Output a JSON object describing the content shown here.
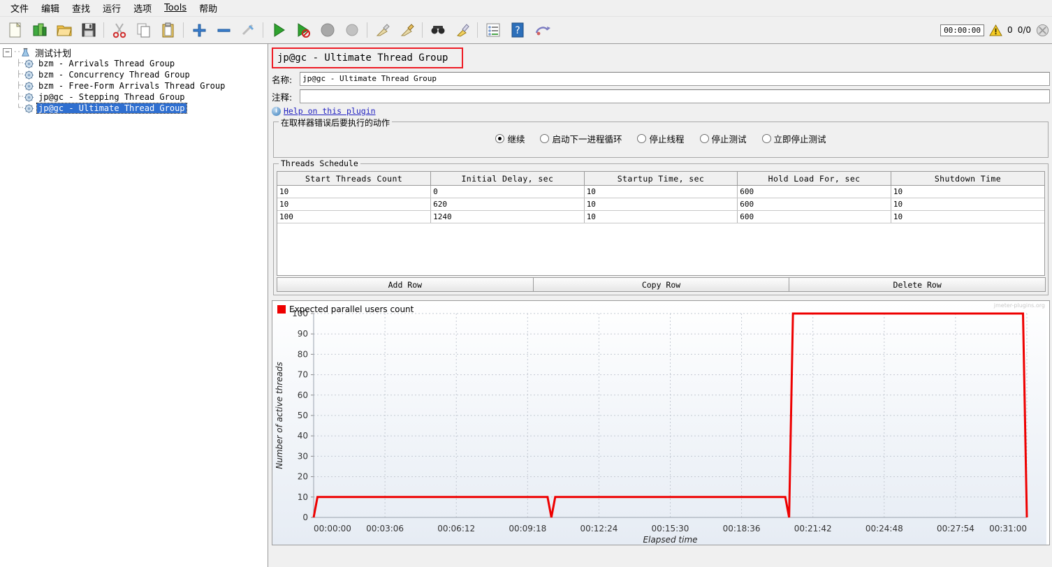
{
  "menu": {
    "items": [
      {
        "label": "文件"
      },
      {
        "label": "编辑"
      },
      {
        "label": "查找"
      },
      {
        "label": "运行"
      },
      {
        "label": "选项"
      },
      {
        "label": "Tools",
        "mnemonic": "T"
      },
      {
        "label": "帮助"
      }
    ]
  },
  "toolbar": {
    "icons": [
      "new-file-icon",
      "templates-icon",
      "open-folder-icon",
      "save-icon",
      "cut-icon",
      "copy-icon",
      "paste-icon",
      "expand-icon",
      "collapse-icon",
      "toggle-icon",
      "start-icon",
      "start-no-pauses-icon",
      "stop-icon",
      "shutdown-icon",
      "clear-icon",
      "clear-all-icon",
      "search-icon",
      "search-reset-icon",
      "function-helper-icon",
      "help-icon",
      "undo-redo-icon"
    ],
    "timer": "00:00:00",
    "warning_count": "0",
    "thread_count": "0/0",
    "status_icon": "disabled-icon"
  },
  "tree": {
    "root": {
      "label": "测试计划",
      "icon": "test-plan-icon",
      "expanded": true,
      "handle": "−"
    },
    "items": [
      {
        "label": "bzm - Arrivals Thread Group",
        "icon": "thread-group-icon",
        "selected": false
      },
      {
        "label": "bzm - Concurrency Thread Group",
        "icon": "thread-group-icon",
        "selected": false
      },
      {
        "label": "bzm - Free-Form Arrivals Thread Group",
        "icon": "thread-group-icon",
        "selected": false
      },
      {
        "label": "jp@gc - Stepping Thread Group",
        "icon": "thread-group-icon",
        "selected": false
      },
      {
        "label": "jp@gc - Ultimate Thread Group",
        "icon": "thread-group-icon",
        "selected": true
      }
    ]
  },
  "panel": {
    "title": "jp@gc - Ultimate Thread Group",
    "title_border_color": "#ee1c25",
    "name_label": "名称:",
    "name_value": "jp@gc - Ultimate Thread Group",
    "comment_label": "注释:",
    "comment_value": "",
    "help_link": "Help on this plugin",
    "error_action": {
      "legend": "在取样器错误后要执行的动作",
      "options": [
        {
          "label": "继续",
          "selected": true
        },
        {
          "label": "启动下一进程循环",
          "selected": false
        },
        {
          "label": "停止线程",
          "selected": false
        },
        {
          "label": "停止测试",
          "selected": false
        },
        {
          "label": "立即停止测试",
          "selected": false
        }
      ]
    },
    "schedule": {
      "legend": "Threads Schedule",
      "columns": [
        "Start Threads Count",
        "Initial Delay, sec",
        "Startup Time, sec",
        "Hold Load For, sec",
        "Shutdown Time"
      ],
      "rows": [
        [
          "10",
          "0",
          "10",
          "600",
          "10"
        ],
        [
          "10",
          "620",
          "10",
          "600",
          "10"
        ],
        [
          "100",
          "1240",
          "10",
          "600",
          "10"
        ]
      ]
    },
    "buttons": [
      {
        "label": "Add Row",
        "name": "add-row-button"
      },
      {
        "label": "Copy Row",
        "name": "copy-row-button"
      },
      {
        "label": "Delete Row",
        "name": "delete-row-button"
      }
    ]
  },
  "chart_data": {
    "type": "line",
    "title": "",
    "legend": [
      {
        "name": "Expected parallel users count",
        "color": "#ee0000"
      }
    ],
    "legend_position": "top-left",
    "watermark": "jmeter-plugins.org",
    "xlabel": "Elapsed time",
    "ylabel": "Number of active threads",
    "xticks": [
      "00:00:00",
      "00:03:06",
      "00:06:12",
      "00:09:18",
      "00:12:24",
      "00:15:30",
      "00:18:36",
      "00:21:42",
      "00:24:48",
      "00:27:54",
      "00:31:00"
    ],
    "xtick_seconds": [
      0,
      186,
      372,
      558,
      744,
      930,
      1116,
      1302,
      1488,
      1674,
      1860
    ],
    "yticks": [
      0,
      10,
      20,
      30,
      40,
      50,
      60,
      70,
      80,
      90,
      100
    ],
    "ylim": [
      0,
      100
    ],
    "xlim": [
      0,
      1860
    ],
    "grid": true,
    "series": [
      {
        "name": "Expected parallel users count",
        "color": "#ee0000",
        "points": [
          [
            0,
            0
          ],
          [
            10,
            10
          ],
          [
            610,
            10
          ],
          [
            620,
            0
          ],
          [
            620,
            0
          ],
          [
            630,
            10
          ],
          [
            1230,
            10
          ],
          [
            1240,
            0
          ],
          [
            1240,
            0
          ],
          [
            1250,
            100
          ],
          [
            1850,
            100
          ],
          [
            1860,
            0
          ]
        ]
      }
    ]
  }
}
